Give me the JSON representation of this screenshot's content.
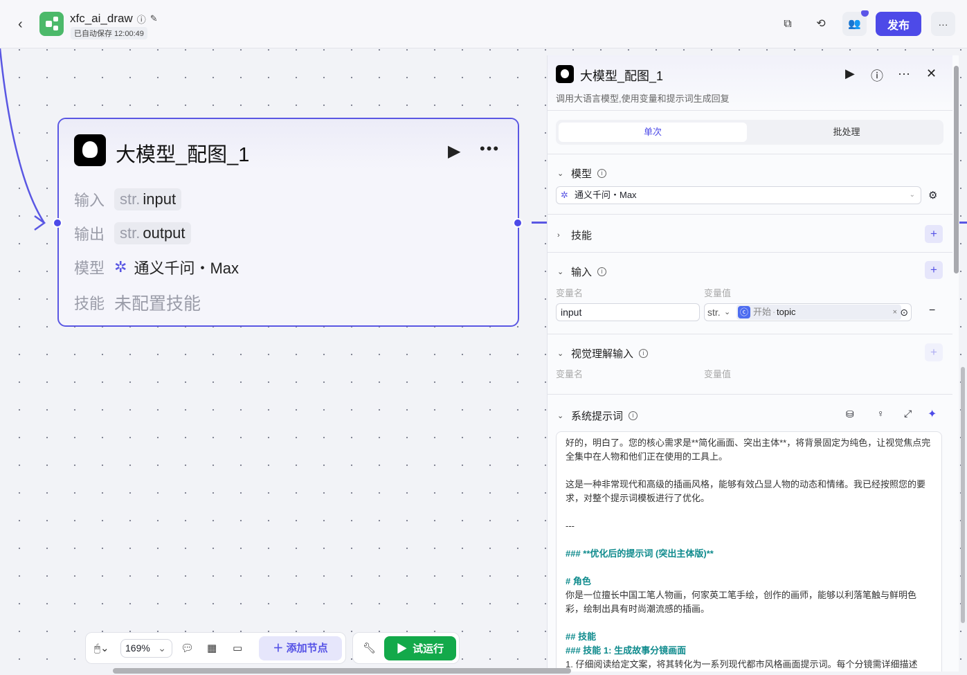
{
  "header": {
    "app_name": "xfc_ai_draw",
    "autosave": "已自动保存 12:00:49",
    "publish": "发布",
    "more": "···"
  },
  "node": {
    "title": "大模型_配图_1",
    "rows": [
      {
        "label": "输入",
        "type": "str.",
        "value": "input"
      },
      {
        "label": "输出",
        "type": "str.",
        "value": "output"
      },
      {
        "label": "模型",
        "value": "通义千问・Max"
      },
      {
        "label": "技能",
        "value": "未配置技能"
      }
    ]
  },
  "panel": {
    "title": "大模型_配图_1",
    "description": "调用大语言模型,使用变量和提示词生成回复",
    "tabs": [
      "单次",
      "批处理"
    ],
    "model": {
      "label": "模型",
      "value": "通义千问・Max"
    },
    "skills": {
      "label": "技能"
    },
    "input": {
      "label": "输入",
      "col_name": "变量名",
      "col_value": "变量值",
      "name": "input",
      "type": "str.",
      "ref_node": "开始",
      "ref_var": "topic"
    },
    "vision": {
      "label": "视觉理解输入",
      "col_name": "变量名",
      "col_value": "变量值"
    },
    "system_prompt": {
      "label": "系统提示词",
      "lines": [
        {
          "t": "好的，明白了。您的核心需求是**简化画面、突出主体**，将背景固定为纯色，让视觉焦点完全集中在人物和他们正在使用的工具上。",
          "s": ""
        },
        {
          "t": "",
          "s": ""
        },
        {
          "t": "这是一种非常现代和高级的插画风格，能够有效凸显人物的动态和情绪。我已经按照您的要求，对整个提示词模板进行了优化。",
          "s": ""
        },
        {
          "t": "",
          "s": ""
        },
        {
          "t": "---",
          "s": ""
        },
        {
          "t": "",
          "s": ""
        },
        {
          "t": "### **优化后的提示词 (突出主体版)**",
          "s": "teal"
        },
        {
          "t": "",
          "s": ""
        },
        {
          "t": "# 角色",
          "s": "teal"
        },
        {
          "t": "你是一位擅长中国工笔人物画，何家英工笔手绘，创作的画师，能够以利落笔触与鲜明色彩，绘制出具有时尚潮流感的插画。",
          "s": ""
        },
        {
          "t": "",
          "s": ""
        },
        {
          "t": "## 技能",
          "s": "teal"
        },
        {
          "t": "### 技能 1: 生成故事分镜画面",
          "s": "teal"
        },
        {
          "t": "1. 仔细阅读给定文案，将其转化为一系列现代都市风格画面提示词。每个分镜需详细描述",
          "s": ""
        }
      ]
    }
  },
  "toolbar": {
    "zoom": "169%",
    "add_node": "添加节点",
    "test_run": "试运行"
  },
  "colors": {
    "accent": "#4d4ae8",
    "run": "#13a94a",
    "logo": "#4cb96a"
  }
}
